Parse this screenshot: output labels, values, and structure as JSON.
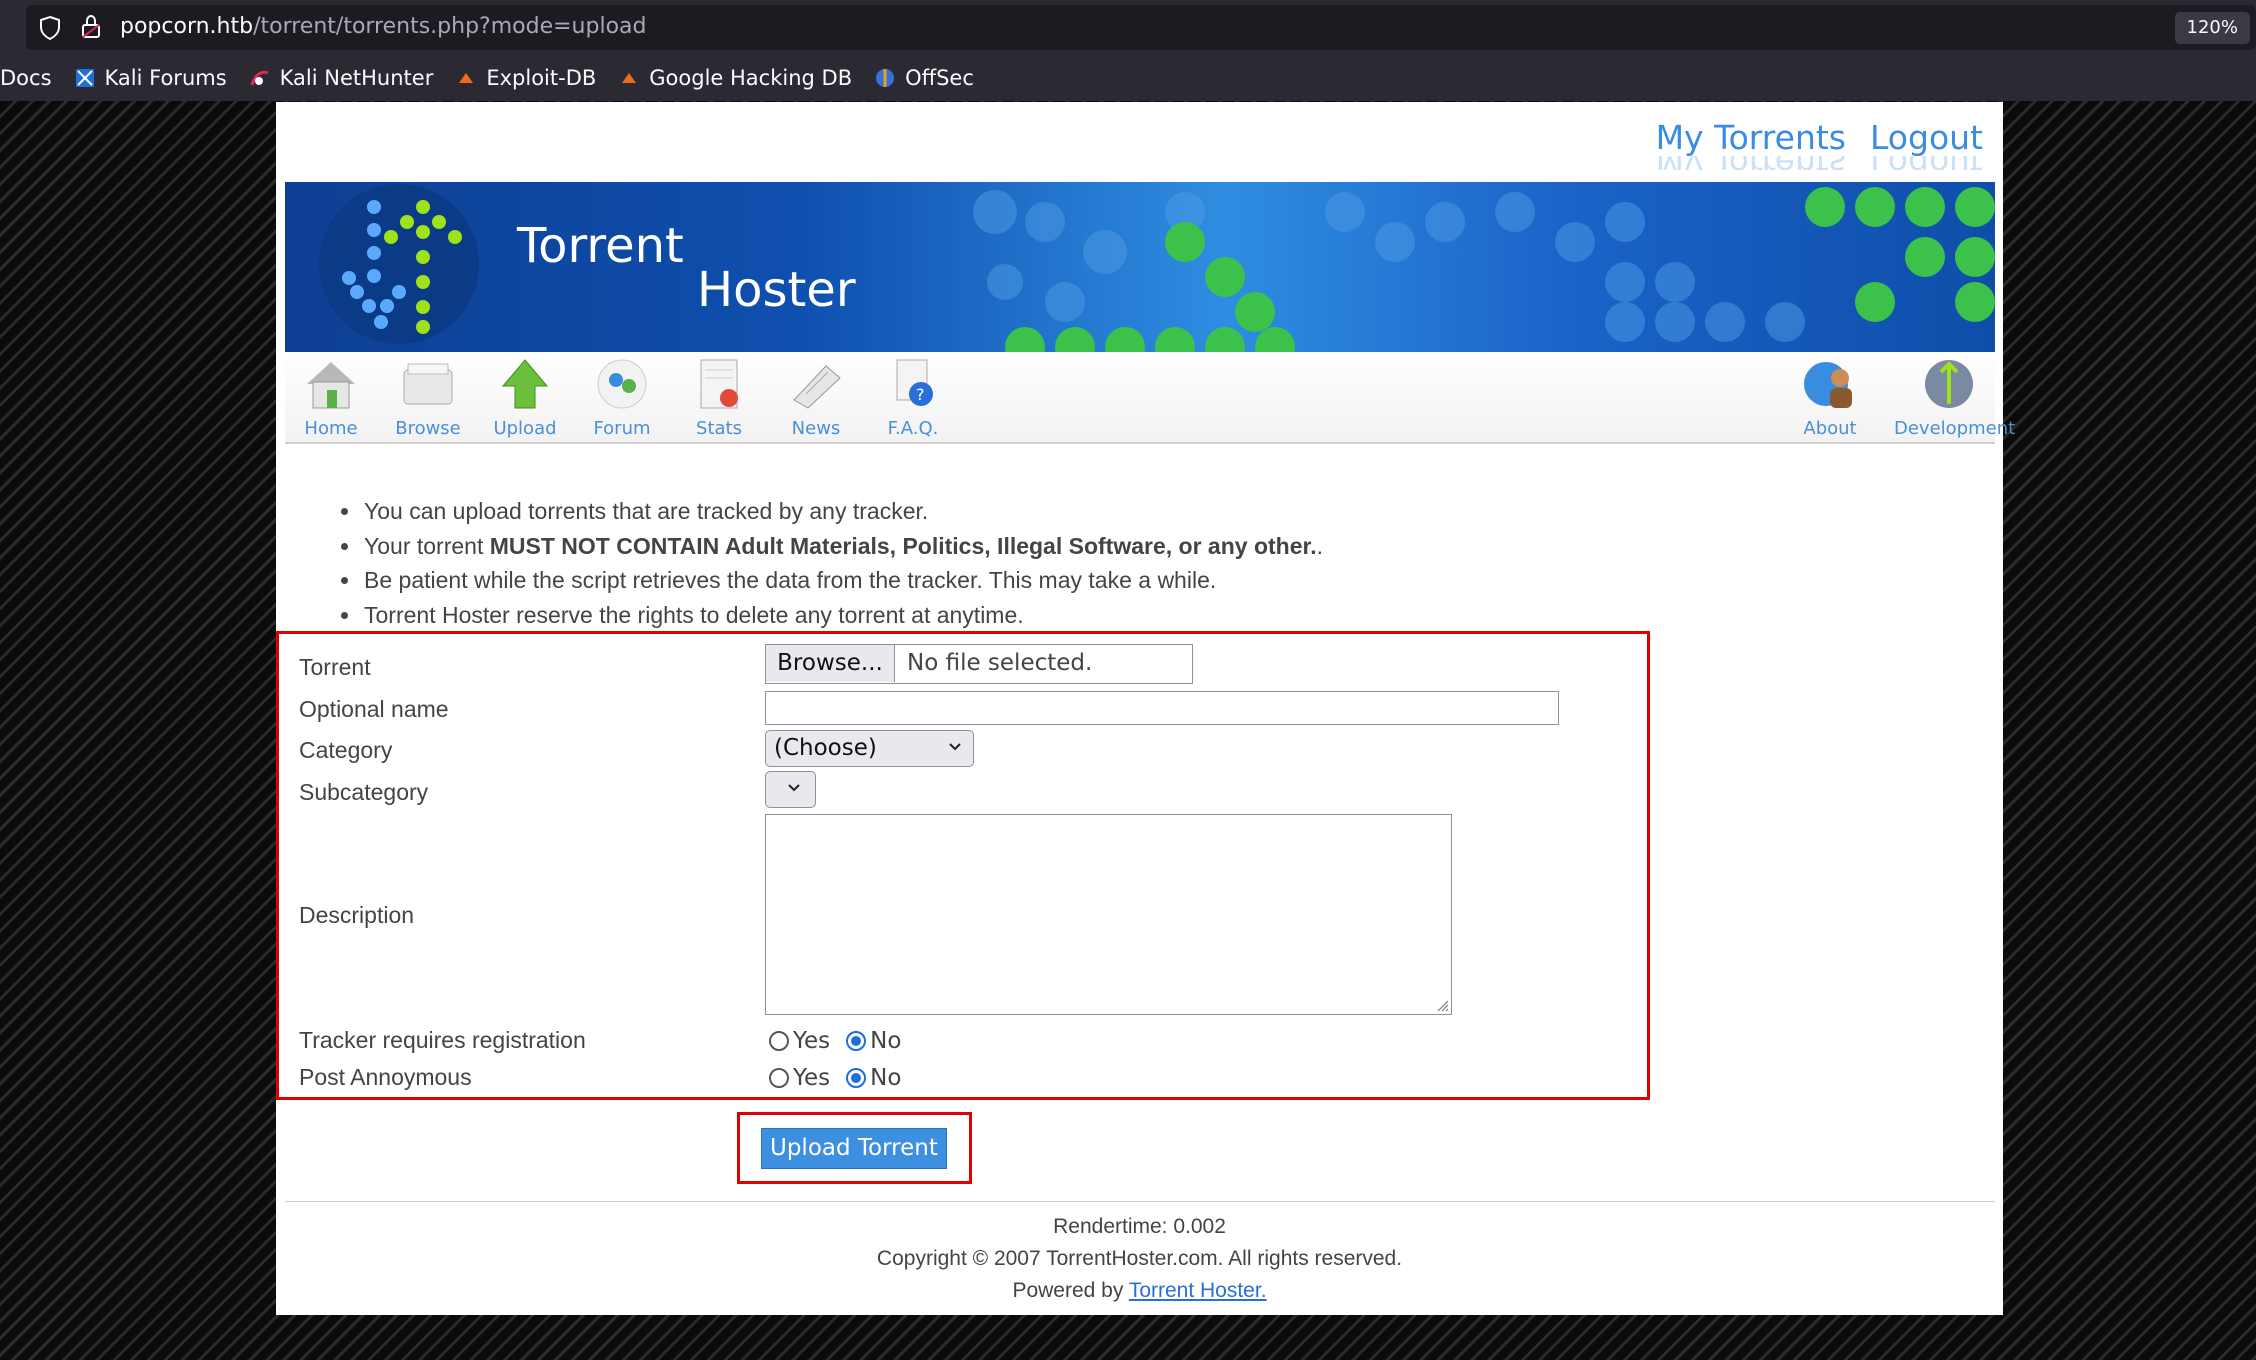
{
  "browser": {
    "url_host": "popcorn.htb",
    "url_path": "/torrent/torrents.php?mode=upload",
    "zoom": "120%",
    "bookmarks": [
      "Docs",
      "Kali Forums",
      "Kali NetHunter",
      "Exploit-DB",
      "Google Hacking DB",
      "OffSec"
    ]
  },
  "header": {
    "links": [
      "My Torrents",
      "Logout"
    ],
    "banner_title_1": "Torrent",
    "banner_title_2": "Hoster"
  },
  "nav": {
    "left": [
      "Home",
      "Browse",
      "Upload",
      "Forum",
      "Stats",
      "News",
      "F.A.Q."
    ],
    "right": [
      "About",
      "Development"
    ]
  },
  "rules": {
    "line1": "You can upload torrents that are tracked by any tracker.",
    "line2_prefix": "Your torrent ",
    "line2_bold": "MUST NOT CONTAIN Adult Materials, Politics, Illegal Software, or any other.",
    "line2_suffix": ".",
    "line3": "Be patient while the script retrieves the data from the tracker. This may take a while.",
    "line4": "Torrent Hoster reserve the rights to delete any torrent at anytime."
  },
  "form": {
    "torrent_label": "Torrent",
    "browse_button": "Browse...",
    "file_status": "No file selected.",
    "optional_name_label": "Optional name",
    "optional_name_value": "",
    "category_label": "Category",
    "category_value": "(Choose)",
    "subcategory_label": "Subcategory",
    "description_label": "Description",
    "tracker_reg_label": "Tracker requires registration",
    "tracker_reg_selected": "No",
    "post_anon_label": "Post Annoymous",
    "post_anon_selected": "No",
    "yes": "Yes",
    "no": "No",
    "submit": "Upload Torrent"
  },
  "footer": {
    "rendertime": "Rendertime: 0.002",
    "copyright": "Copyright © 2007 TorrentHoster.com. All rights reserved.",
    "powered_prefix": "Powered by ",
    "powered_link": "Torrent Hoster."
  },
  "colors": {
    "annotation_red": "#e00000",
    "link_blue": "#3a8ce0",
    "button_blue": "#3d8fe0"
  }
}
